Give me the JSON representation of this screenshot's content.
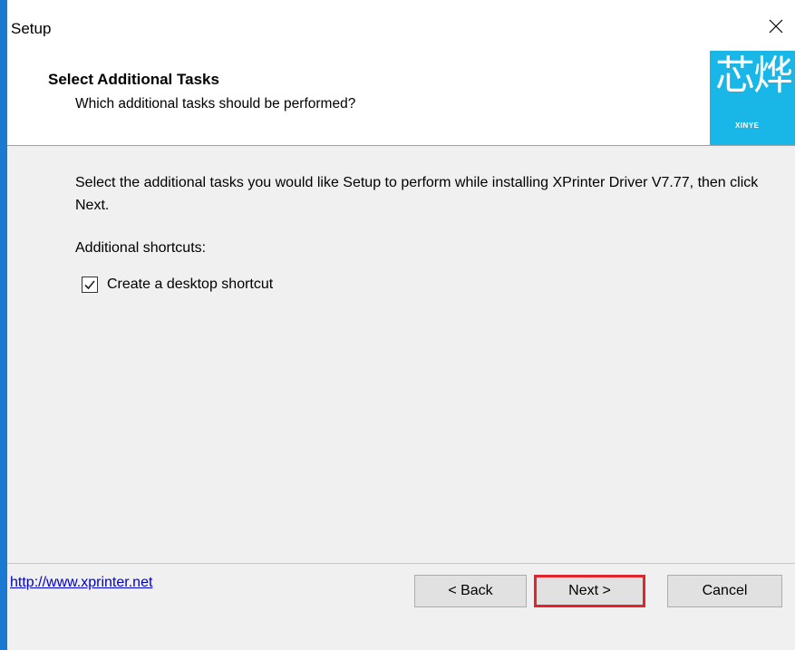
{
  "window": {
    "title": "Setup"
  },
  "header": {
    "title": "Select Additional Tasks",
    "subtitle": "Which additional tasks should be performed?",
    "logo": {
      "glyphs": "芯烨",
      "caption": "XINYE"
    }
  },
  "content": {
    "description": "Select the additional tasks you would like Setup to perform while installing XPrinter Driver V7.77, then click Next.",
    "shortcuts_label": "Additional shortcuts:",
    "desktop_shortcut": {
      "label": "Create a desktop shortcut",
      "checked": true
    }
  },
  "footer": {
    "link": "http://www.xprinter.net",
    "back_label": "< Back",
    "next_label": "Next >",
    "cancel_label": "Cancel"
  },
  "colors": {
    "accent": "#1a79d0",
    "logo_bg": "#19b6e8",
    "highlight": "#e2252b",
    "link": "#0000cc"
  },
  "icons": {
    "close": "close-icon",
    "check": "check-icon"
  }
}
